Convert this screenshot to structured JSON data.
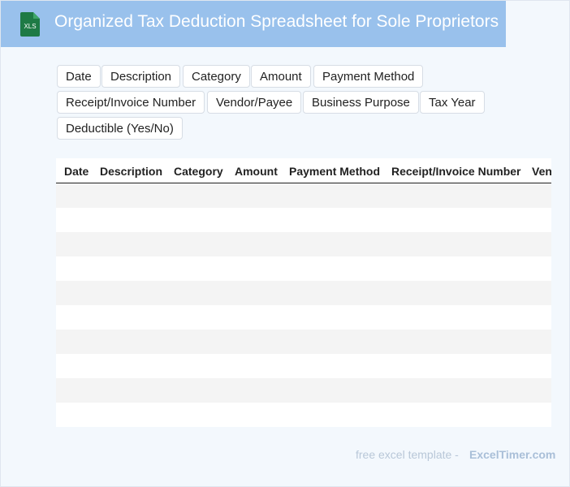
{
  "header": {
    "icon": "xls-file-icon",
    "icon_label": "XLS",
    "title": "Organized Tax Deduction Spreadsheet for Sole Proprietors"
  },
  "chips": [
    "Date",
    "Description",
    "Category",
    "Amount",
    "Payment Method",
    "Receipt/Invoice Number",
    "Vendor/Payee",
    "Business Purpose",
    "Tax Year",
    "Deductible (Yes/No)"
  ],
  "table": {
    "columns": [
      "Date",
      "Description",
      "Category",
      "Amount",
      "Payment Method",
      "Receipt/Invoice Number",
      "Ven"
    ]
  },
  "footer": {
    "text": "free excel template -",
    "brand": "ExcelTimer.com"
  },
  "colors": {
    "banner": "#99c1ec",
    "background": "#f3f8fd",
    "icon_green": "#1e7a45"
  }
}
